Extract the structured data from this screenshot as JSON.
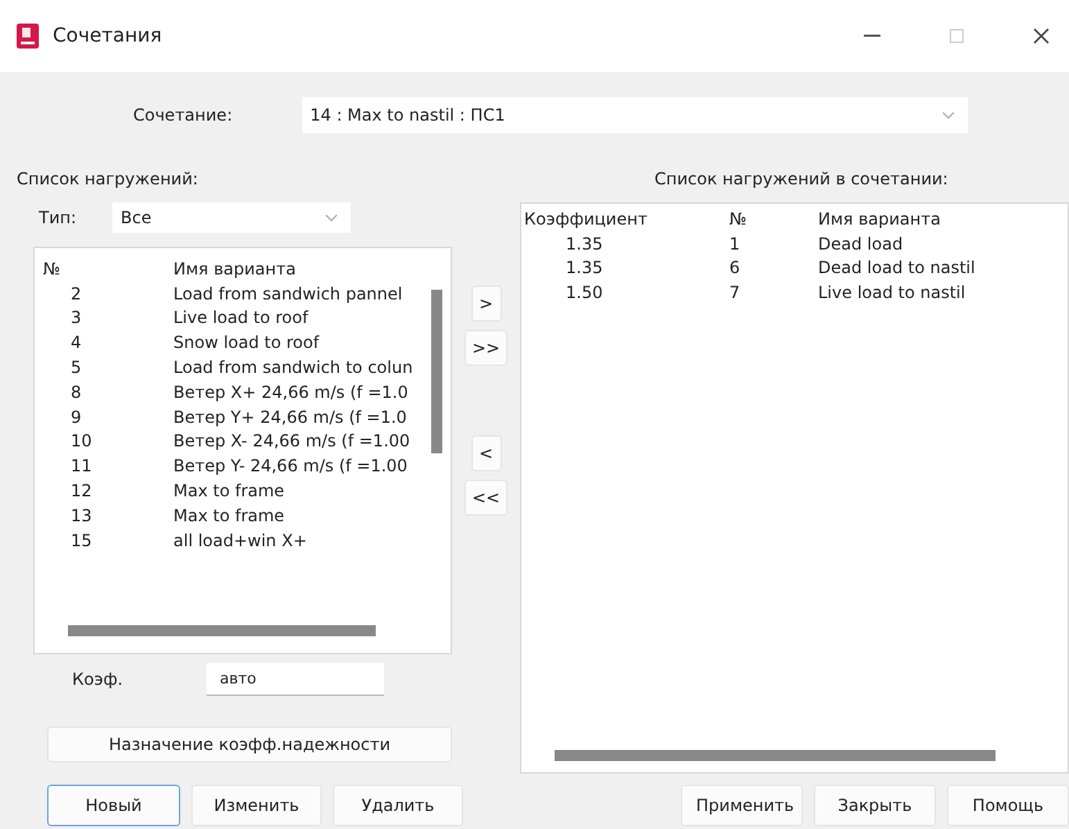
{
  "window": {
    "title": "Сочетания"
  },
  "combination": {
    "label": "Сочетание:",
    "value": "14 : Max to nastil : ПС1"
  },
  "loads_panel": {
    "heading": "Список нагружений:",
    "type_label": "Тип:",
    "type_value": "Все",
    "columns": [
      "№",
      "Имя варианта"
    ],
    "rows": [
      {
        "number": "2",
        "name": "Load from sandwich pannel"
      },
      {
        "number": "3",
        "name": "Live load to roof"
      },
      {
        "number": "4",
        "name": "Snow load to roof"
      },
      {
        "number": "5",
        "name": "Load from sandwich to colun"
      },
      {
        "number": "8",
        "name": "Ветер X+ 24,66 m/s (f =1.0"
      },
      {
        "number": "9",
        "name": "Ветер Y+ 24,66 m/s (f =1.0"
      },
      {
        "number": "10",
        "name": "Ветер X- 24,66 m/s (f =1.00"
      },
      {
        "number": "11",
        "name": "Ветер Y- 24,66 m/s (f =1.00"
      },
      {
        "number": "12",
        "name": "Max to frame"
      },
      {
        "number": "13",
        "name": "Max to frame"
      },
      {
        "number": "15",
        "name": "all load+win X+"
      }
    ],
    "coef_label": "Коэф.",
    "coef_value": "авто",
    "reliability_button": "Назначение коэфф.надежности"
  },
  "transfer_buttons": [
    ">",
    ">>",
    "<",
    "<<"
  ],
  "combination_panel": {
    "heading": "Список нагружений в сочетании:",
    "columns": [
      "Коэффициент",
      "№",
      "Имя варианта"
    ],
    "rows": [
      {
        "coefficient": "1.35",
        "number": "1",
        "name": "Dead load"
      },
      {
        "coefficient": "1.35",
        "number": "6",
        "name": "Dead load to nastil"
      },
      {
        "coefficient": "1.50",
        "number": "7",
        "name": "Live load to nastil"
      }
    ]
  },
  "left_buttons": [
    {
      "label": "Новый",
      "focused": true
    },
    {
      "label": "Изменить",
      "focused": false
    },
    {
      "label": "Удалить",
      "focused": false
    }
  ],
  "right_buttons": [
    {
      "label": "Применить",
      "focused": false
    },
    {
      "label": "Закрыть",
      "focused": false
    },
    {
      "label": "Помощь",
      "focused": false
    }
  ]
}
